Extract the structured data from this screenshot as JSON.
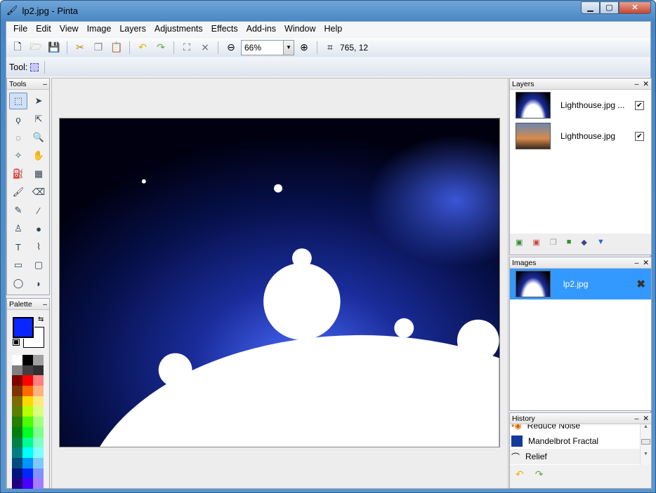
{
  "window": {
    "title": "lp2.jpg - Pinta",
    "minimize": "▁",
    "maximize": "▢",
    "close": "✕"
  },
  "menu": [
    "File",
    "Edit",
    "View",
    "Image",
    "Layers",
    "Adjustments",
    "Effects",
    "Add-ins",
    "Window",
    "Help"
  ],
  "toolbar": {
    "zoom_value": "66%",
    "cursor_position": "765, 12"
  },
  "toolrow": {
    "label": "Tool:"
  },
  "tools_panel": {
    "title": "Tools",
    "minimize": "–",
    "tools": [
      {
        "name": "rectangle-select",
        "glyph": "⬚",
        "selected": true
      },
      {
        "name": "move-selected",
        "glyph": "➤"
      },
      {
        "name": "lasso-select",
        "glyph": "ϙ"
      },
      {
        "name": "move-selection",
        "glyph": "⇱"
      },
      {
        "name": "ellipse-select",
        "glyph": "◌"
      },
      {
        "name": "zoom",
        "glyph": "🔍"
      },
      {
        "name": "magic-wand",
        "glyph": "✧"
      },
      {
        "name": "pan",
        "glyph": "✋"
      },
      {
        "name": "paint-bucket",
        "glyph": "⛽"
      },
      {
        "name": "gradient",
        "glyph": "▦"
      },
      {
        "name": "paintbrush",
        "glyph": "🖌"
      },
      {
        "name": "eraser",
        "glyph": "⌫"
      },
      {
        "name": "pencil",
        "glyph": "✎"
      },
      {
        "name": "color-picker",
        "glyph": "⁄"
      },
      {
        "name": "clone-stamp",
        "glyph": "♙"
      },
      {
        "name": "recolor",
        "glyph": "●"
      },
      {
        "name": "text",
        "glyph": "T"
      },
      {
        "name": "line-curve",
        "glyph": "⌇"
      },
      {
        "name": "rectangle",
        "glyph": "▭"
      },
      {
        "name": "rounded-rectangle",
        "glyph": "▢"
      },
      {
        "name": "ellipse",
        "glyph": "◯"
      },
      {
        "name": "freeform-shape",
        "glyph": "◗"
      }
    ]
  },
  "palette_panel": {
    "title": "Palette",
    "minimize": "–",
    "primary_color": "#0a26ff",
    "secondary_color": "#ffffff",
    "colors": [
      "#ffffff",
      "#000000",
      "#a0a0a0",
      "#808080",
      "#404040",
      "#303030",
      "#7f0000",
      "#ff0000",
      "#ff7f7f",
      "#7f3300",
      "#ff6a00",
      "#ffb27f",
      "#7f6a00",
      "#ffd800",
      "#ffe97f",
      "#5b7f00",
      "#b6ff00",
      "#daff7f",
      "#267f00",
      "#4cff00",
      "#a5ff7f",
      "#007f0e",
      "#00ff21",
      "#7fff8e",
      "#007f46",
      "#00ff90",
      "#7fffc5",
      "#007f7f",
      "#00ffff",
      "#7fffff",
      "#004a7f",
      "#0094ff",
      "#7fc9ff",
      "#00137f",
      "#0026ff",
      "#7f92ff",
      "#21007f",
      "#4800ff",
      "#a17fff"
    ]
  },
  "layers_panel": {
    "title": "Layers",
    "minimize": "–",
    "close": "✕",
    "layers": [
      {
        "name": "Lighthouse.jpg ...",
        "visible": true
      },
      {
        "name": "Lighthouse.jpg",
        "visible": true
      }
    ]
  },
  "images_panel": {
    "title": "Images",
    "minimize": "–",
    "close": "✕",
    "images": [
      {
        "name": "lp2.jpg",
        "selected": true
      }
    ]
  },
  "history_panel": {
    "title": "History",
    "minimize": "–",
    "close": "✕",
    "items": [
      "Reduce Noise",
      "Mandelbrot Fractal",
      "Relief"
    ]
  },
  "colors": {
    "accent": "#3399ff",
    "selection": "#cfe0f7"
  }
}
